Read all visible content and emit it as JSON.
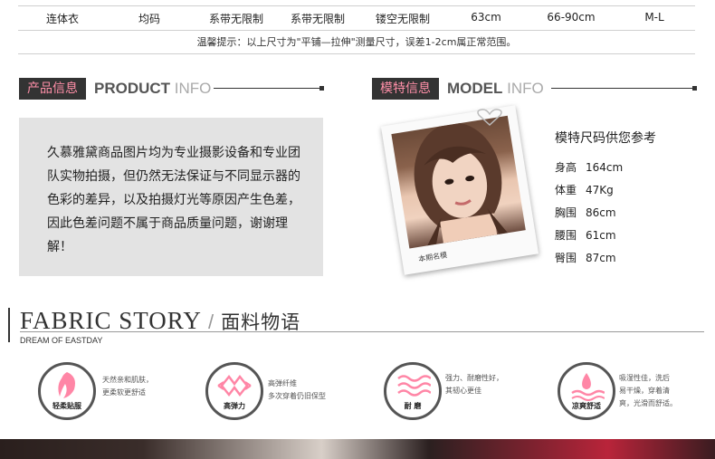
{
  "size_table": {
    "cells": [
      "连体衣",
      "均码",
      "系带无限制",
      "系带无限制",
      "镂空无限制",
      "63cm",
      "66-90cm",
      "M-L"
    ],
    "tip": "温馨提示：以上尺寸为\"平铺—拉伸\"测量尺寸，误差1-2cm属正常范围。"
  },
  "product_section": {
    "label": "产品信息",
    "en_bold": "PRODUCT",
    "en_light": "INFO",
    "text": "久慕雅黛商品图片均为专业摄影设备和专业团队实物拍摄，但仍然无法保证与不同显示器的色彩的差异，以及拍摄灯光等原因产生色差，因此色差问题不属于商品质量问题，谢谢理解！"
  },
  "model_section": {
    "label": "模特信息",
    "en_bold": "MODEL",
    "en_light": "INFO",
    "photo_caption": "本期名模",
    "title": "模特尺码供您参考",
    "stats": [
      {
        "k": "身高",
        "v": "164cm"
      },
      {
        "k": "体重",
        "v": "47Kg"
      },
      {
        "k": "胸围",
        "v": "86cm"
      },
      {
        "k": "腰围",
        "v": "61cm"
      },
      {
        "k": "臀围",
        "v": "87cm"
      }
    ]
  },
  "fabric": {
    "title_en": "FABRIC STORY",
    "slash": " / ",
    "title_cn": "面料物语",
    "subtitle": "DREAM OF EASTDAY",
    "features": [
      {
        "label": "轻柔贴服",
        "icon": "feather-icon",
        "desc1": "天然亲和肌肤，",
        "desc2": "更柔软更舒适"
      },
      {
        "label": "高弹力",
        "icon": "stretch-arrows-icon",
        "desc1": "高弹纤维",
        "desc2": "多次穿着仍旧保型"
      },
      {
        "label": "耐 磨",
        "icon": "waves-icon",
        "desc1": "强力、耐磨性好，",
        "desc2": "其韧心更佳"
      },
      {
        "label": "凉爽舒适",
        "icon": "water-drop-icon",
        "desc1": "吸湿性佳，洗后",
        "desc2": "易干燥，穿着清",
        "desc3": "爽，光滑而舒适。"
      }
    ]
  },
  "colors": {
    "accent_pink": "#ff8fa8",
    "dark": "#333333",
    "panel": "#e3e3e3"
  }
}
